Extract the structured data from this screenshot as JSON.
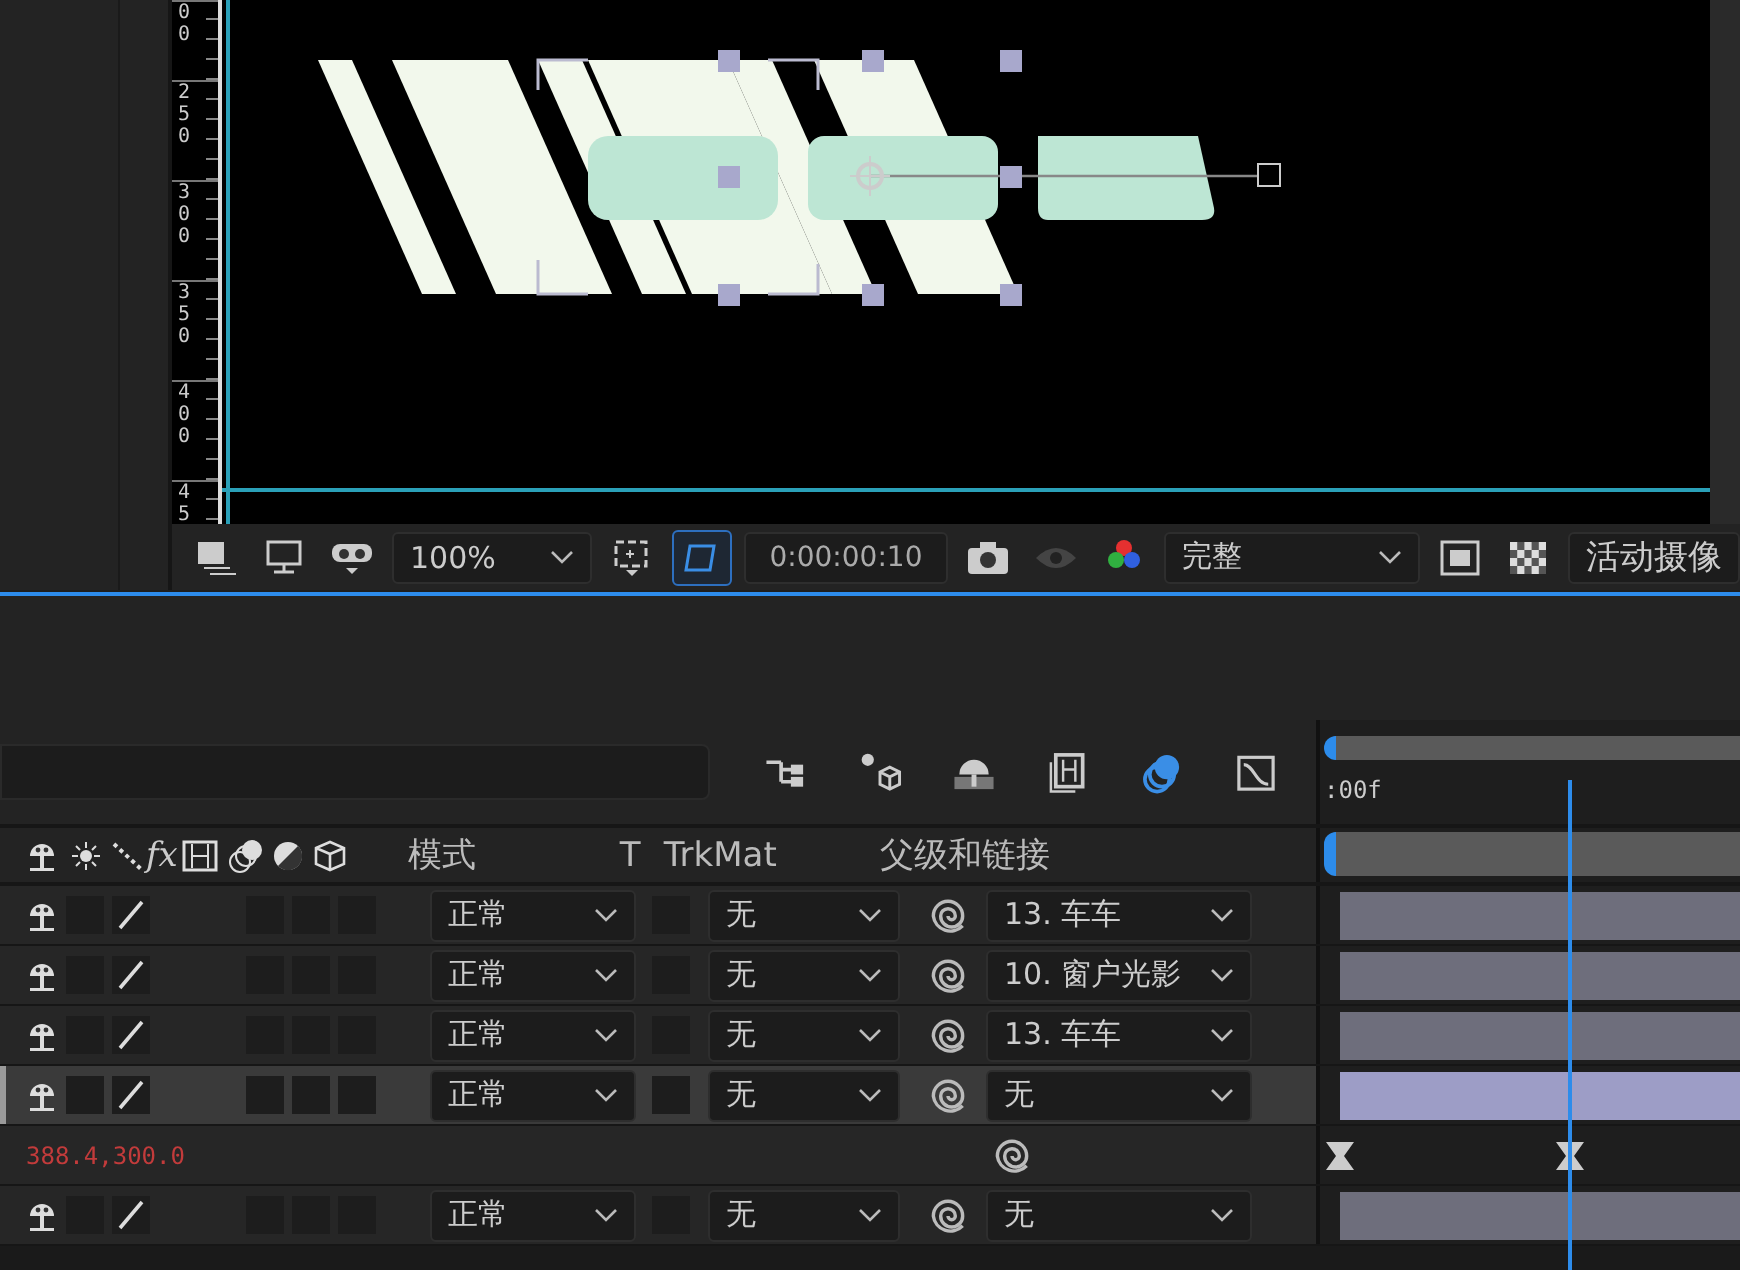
{
  "viewer": {
    "ruler_labels": [
      "00",
      "250",
      "300",
      "350",
      "400",
      "45"
    ],
    "toolbar": {
      "zoom": "100%",
      "mask_toggle": {
        "on": true
      },
      "timecode": "0:00:00:10",
      "resolution": "完整",
      "camera": "活动摄像"
    }
  },
  "timeline": {
    "tools": [
      {
        "kind": "flowchart",
        "on": false
      },
      {
        "kind": "draft3d",
        "on": false
      },
      {
        "kind": "shy",
        "on": false
      },
      {
        "kind": "frameblend",
        "on": false
      },
      {
        "kind": "motionblur",
        "on": true
      },
      {
        "kind": "graph",
        "on": false
      }
    ],
    "ruler_start": ":00f",
    "columns": {
      "fx": "fx",
      "mode": "模式",
      "t": "T",
      "trkmat": "TrkMat",
      "parent": "父级和链接"
    },
    "rows": [
      {
        "kind": "layer",
        "selected": false,
        "mode": "正常",
        "trkmat": "无",
        "parent": "13. 车车"
      },
      {
        "kind": "layer",
        "selected": false,
        "mode": "正常",
        "trkmat": "无",
        "parent": "10. 窗户光影"
      },
      {
        "kind": "layer",
        "selected": false,
        "mode": "正常",
        "trkmat": "无",
        "parent": "13. 车车"
      },
      {
        "kind": "layer",
        "selected": true,
        "mode": "正常",
        "trkmat": "无",
        "parent": "无"
      },
      {
        "kind": "property",
        "value": "388.4,300.0"
      },
      {
        "kind": "layer",
        "selected": false,
        "mode": "正常",
        "trkmat": "无",
        "parent": "无"
      }
    ]
  }
}
